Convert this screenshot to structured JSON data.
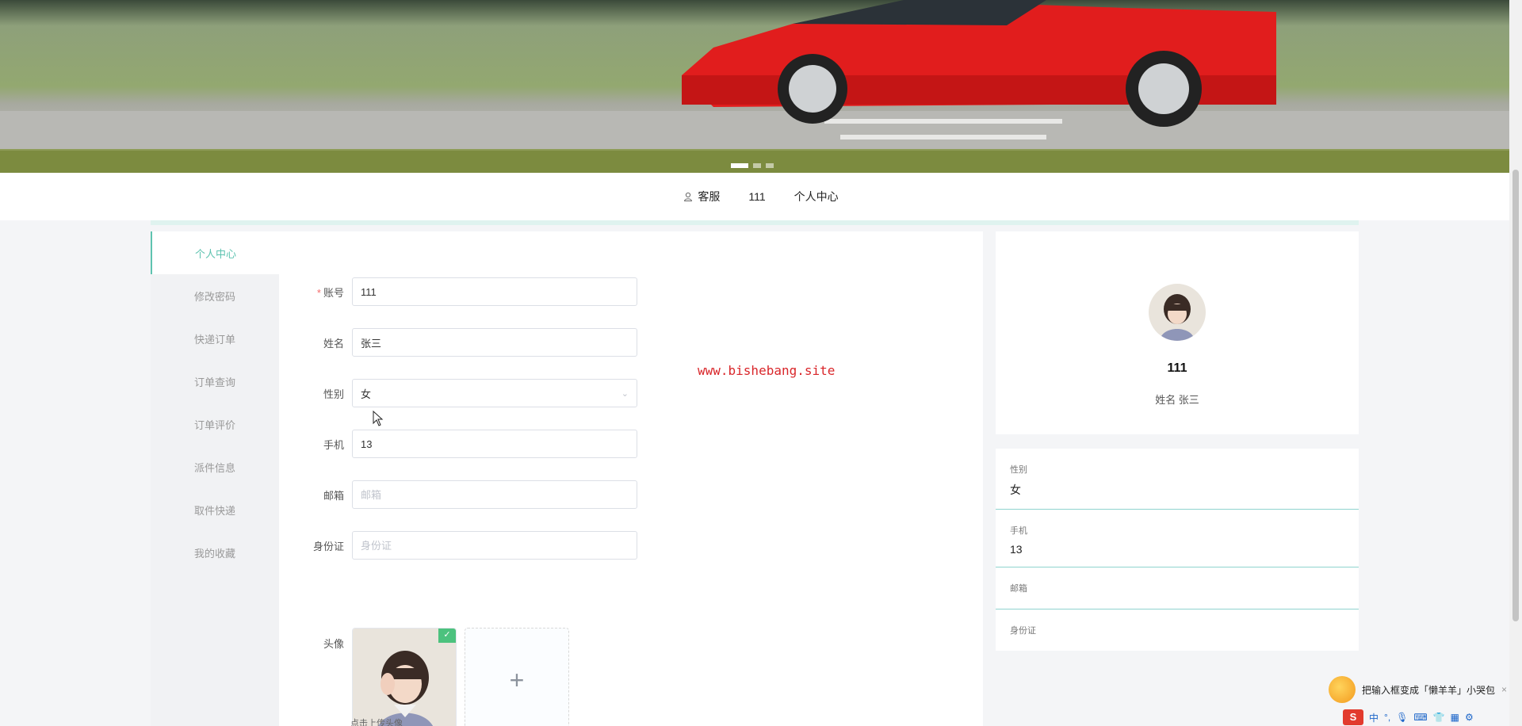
{
  "banner": {
    "dots": 3,
    "active_dot": 0
  },
  "nav": {
    "customer_service": "客服",
    "username": "111",
    "personal_center": "个人中心"
  },
  "sidebar": {
    "items": [
      {
        "label": "个人中心",
        "active": true
      },
      {
        "label": "修改密码"
      },
      {
        "label": "快递订单"
      },
      {
        "label": "订单查询"
      },
      {
        "label": "订单评价"
      },
      {
        "label": "派件信息"
      },
      {
        "label": "取件快递"
      },
      {
        "label": "我的收藏"
      }
    ]
  },
  "form": {
    "account": {
      "label": "账号",
      "required": "*",
      "value": "111"
    },
    "name": {
      "label": "姓名",
      "value": "张三"
    },
    "gender": {
      "label": "性别",
      "value": "女"
    },
    "phone": {
      "label": "手机",
      "value": "13"
    },
    "email": {
      "label": "邮箱",
      "placeholder": "邮箱"
    },
    "id_card": {
      "label": "身份证",
      "placeholder": "身份证"
    },
    "avatar": {
      "label": "头像",
      "upload_icon": "+",
      "hint": "点击上传头像"
    }
  },
  "watermark": "www.bishebang.site",
  "profile": {
    "name": "111",
    "subtitle": "姓名 张三"
  },
  "info": [
    {
      "key": "性别",
      "value": "女"
    },
    {
      "key": "手机",
      "value": "13"
    },
    {
      "key": "邮箱",
      "value": ""
    },
    {
      "key": "身份证",
      "value": ""
    }
  ],
  "ime": {
    "tip": "把输入框变成「懒羊羊」小哭包",
    "logo": "S",
    "mode": "中"
  },
  "colors": {
    "accent": "#5ec3b0",
    "required": "#f56c6c",
    "watermark": "#d9262a"
  }
}
